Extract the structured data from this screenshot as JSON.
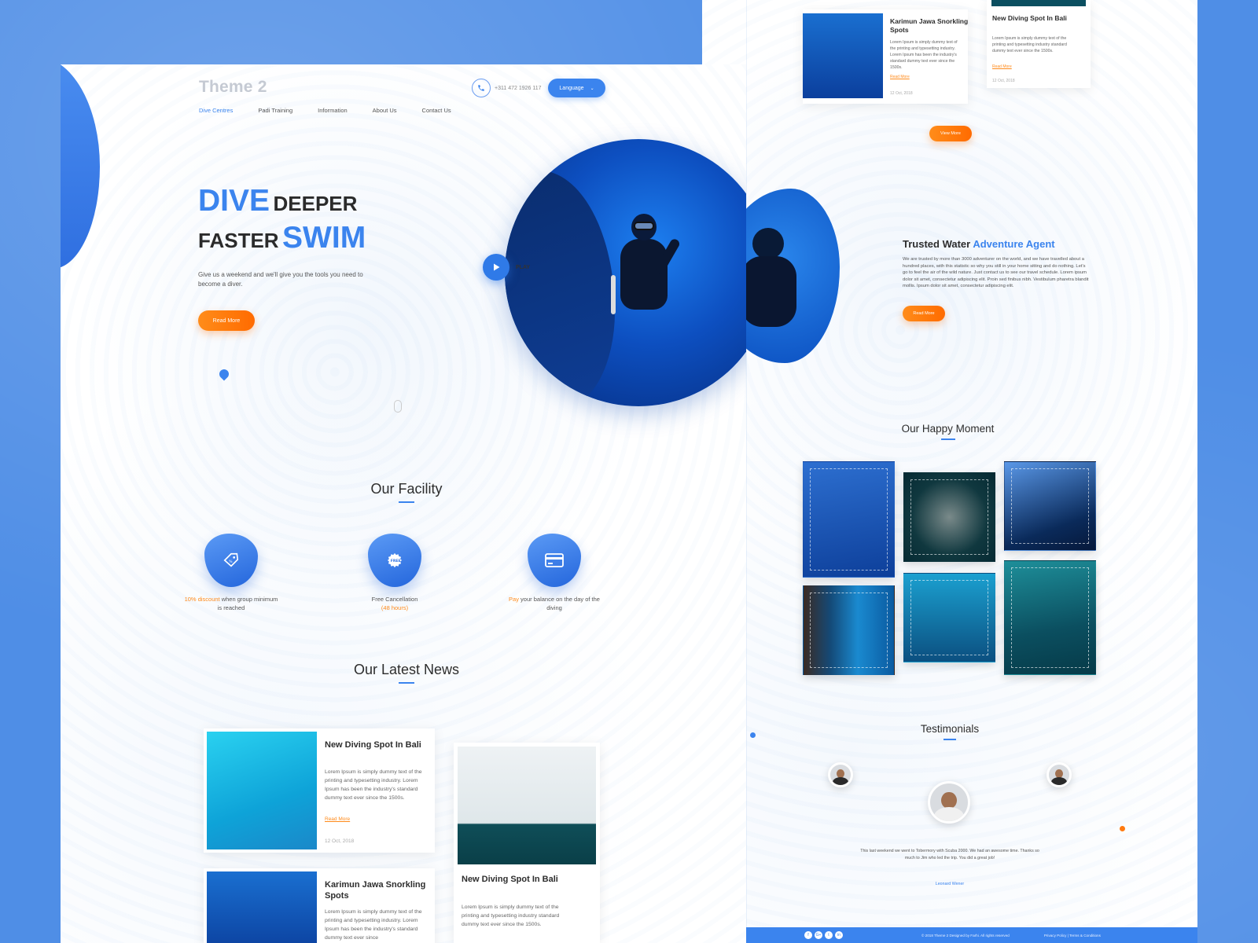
{
  "brand": {
    "logo": "Theme 2",
    "phone": "+311 472 1926 117",
    "language_label": "Language"
  },
  "nav": [
    "Dive Centres",
    "Padi Training",
    "Information",
    "About Us",
    "Contact Us"
  ],
  "hero": {
    "word1": "DIVE",
    "word2": "DEEPER",
    "word3": "FASTER",
    "word4": "SWIM",
    "subtitle": "Give us a weekend and we'll give you the tools you need to become a diver.",
    "button": "Read More",
    "play_label": "PLAY"
  },
  "facility": {
    "title": "Our Facility",
    "items": [
      {
        "icon": "discount-tag-icon",
        "highlight": "10% discount",
        "text": " when group minimum is reached"
      },
      {
        "icon": "free-badge-icon",
        "text": "Free Cancellation",
        "highlight": "(48 hours)"
      },
      {
        "icon": "credit-card-icon",
        "highlight": "Pay",
        "text": " your balance on the day of the diving"
      }
    ]
  },
  "news": {
    "title": "Our Latest News",
    "cards": [
      {
        "title": "New Diving Spot In Bali",
        "body": "Lorem Ipsum is simply dummy text of the printing and typesetting industry. Lorem Ipsum has been the industry's standard dummy text ever since the 1500s.",
        "link": "Read More",
        "date": "12 Oct, 2018"
      },
      {
        "title": "New Diving Spot In Bali",
        "body": "Lorem Ipsum is simply dummy text of the printing and typesetting industry standard dummy text ever since the 1500s."
      },
      {
        "title": "Karimun Jawa Snorkling Spots",
        "body": "Lorem Ipsum is simply dummy text of the printing and typesetting industry. Lorem Ipsum has been the industry's standard dummy text ever since"
      }
    ]
  },
  "right": {
    "cards": [
      {
        "title": "Karimun Jawa Snorkling Spots",
        "body": "Lorem Ipsum is simply dummy text of the printing and typesetting industry. Lorem Ipsum has been the industry's standard dummy text ever since the 1500s.",
        "link": "Read More",
        "date": "12 Oct, 2018"
      },
      {
        "title": "New Diving Spot In Bali",
        "body": "Lorem Ipsum is simply dummy text of the printing and typesetting industry standard dummy text ever since the 1500s.",
        "link": "Read More",
        "date": "12 Oct, 2018"
      }
    ],
    "view_more": "View More",
    "trust": {
      "title_a": "Trusted Water ",
      "title_b": "Adventure Agent",
      "body": "We are trusted by more than 3000 adventurer on the world, and we have travelled about a hundred places, with this statistic so why you still in your home sitting and do nothing. Let's go to feel the air of the wild nature. Just contact us to see our travel schedule. Lorem ipsum dolor sit amet, consectetur adipiscing elit. Proin sed finibus nibh. Vestibulum pharetra blandit mollis. Ipsum dolor sit amet, consectetur adipiscing elit.",
      "button": "Read More"
    },
    "happy_title": "Our Happy Moment",
    "testimonials": {
      "title": "Testimonials",
      "quote": "This last weekend we went to Tobermory with Scuba 2000. We had an awesome time. Thanks so much to Jim who led the trip. You did a great job!",
      "name": "Leonard Wener"
    },
    "footer": {
      "social": [
        "f",
        "G+",
        "t",
        "in"
      ],
      "copyright": "© 2018 Theme 2 Designed by Farhi. All rights reserved",
      "legal": "Privacy Policy | Terms & Conditions"
    }
  }
}
